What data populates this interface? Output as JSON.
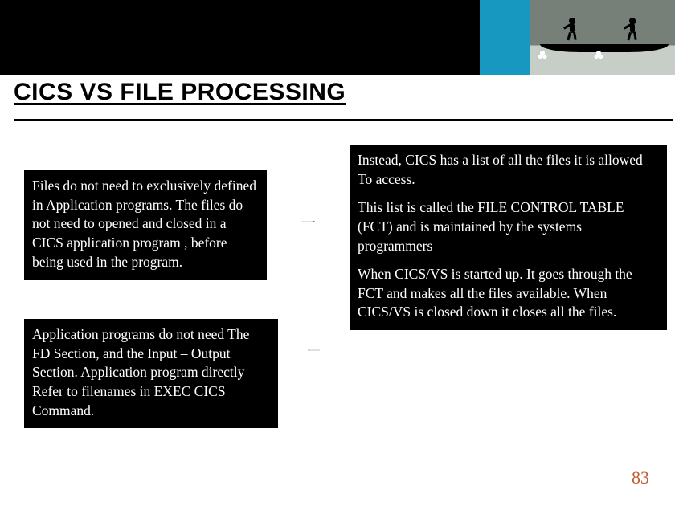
{
  "colors": {
    "teal": "#1798c1",
    "pagenum": "#c05a2a"
  },
  "header": {
    "image_alt": "rowers-photo"
  },
  "title": "CICS VS FILE PROCESSING",
  "boxA": {
    "p1": "Files do not need to exclusively defined in Application programs. The files do not need to opened and closed in a CICS application program , before being used in the program."
  },
  "boxB": {
    "p1": "Instead, CICS has a list of all the files it is allowed To access.",
    "p2": "This list is called the FILE CONTROL TABLE (FCT) and is maintained by the systems programmers",
    "p3": "When CICS/VS is started up. It goes through the FCT and makes all the files available. When CICS/VS is closed down it closes all the files."
  },
  "boxC": {
    "p1": "Application programs do not need The FD Section, and the Input – Output Section. Application program directly Refer to filenames in EXEC CICS Command."
  },
  "page_number": "83"
}
